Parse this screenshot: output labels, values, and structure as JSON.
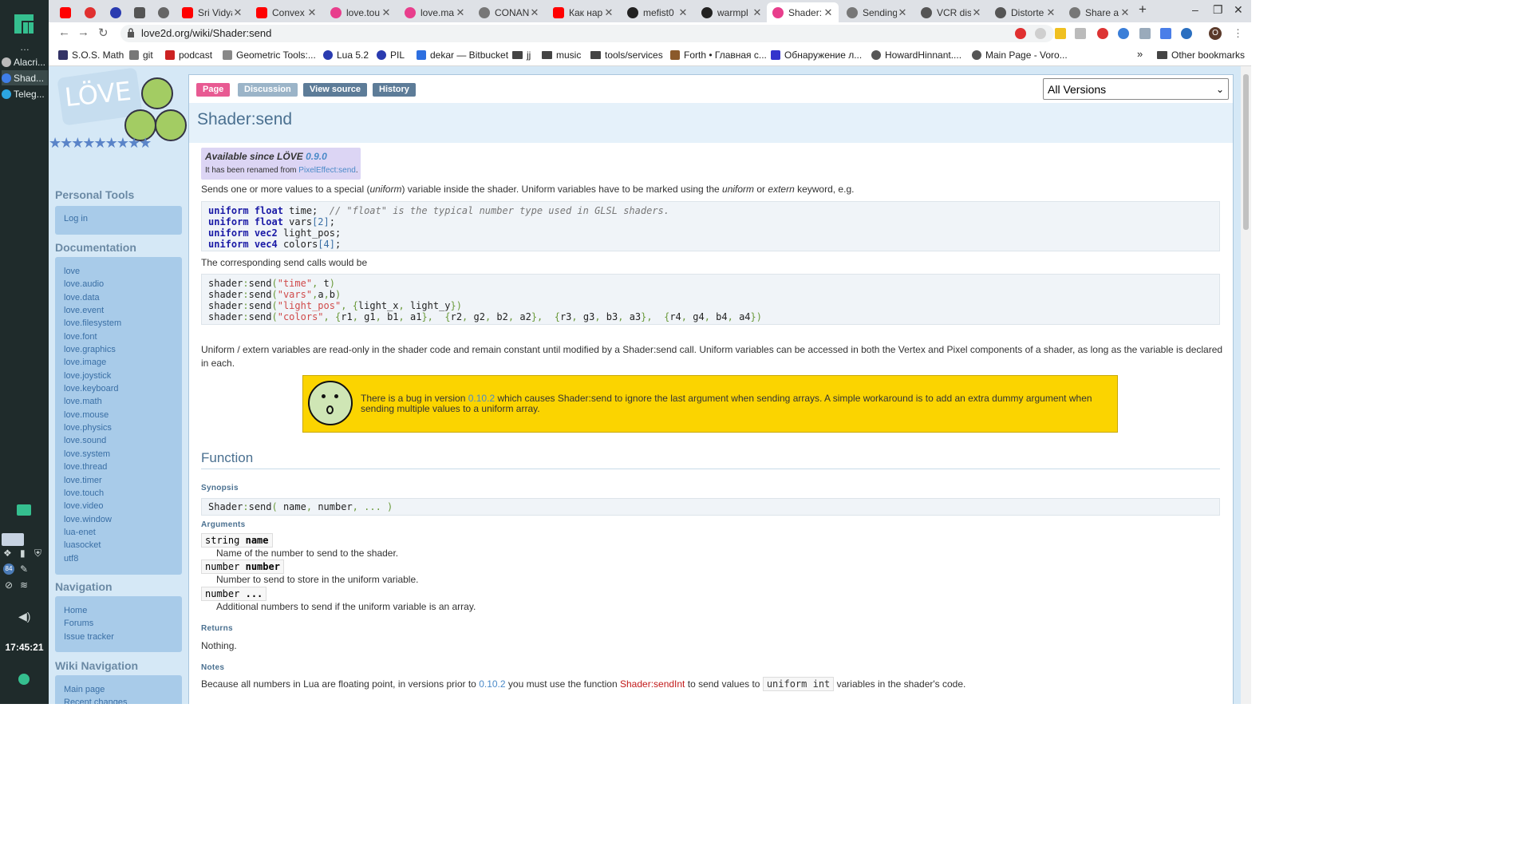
{
  "os_panel": {
    "windows": [
      {
        "label": "Alacri...",
        "color": "#bbbbbb"
      },
      {
        "label": "Shad...",
        "color": "#3f7ee8"
      },
      {
        "label": "Teleg...",
        "color": "#2ca5e0"
      }
    ],
    "badge": "84",
    "clock": "17:45:21"
  },
  "tabs": [
    {
      "title": "",
      "color": "#ff0000"
    },
    {
      "title": "",
      "color": "#e03030"
    },
    {
      "title": "",
      "color": "#2a3bb0"
    },
    {
      "title": "",
      "color": "#555555"
    },
    {
      "title": "",
      "color": "#666666"
    },
    {
      "title": "Sri Vidya",
      "color": "#ff0000"
    },
    {
      "title": "Convex",
      "color": "#ff0000"
    },
    {
      "title": "love.tou",
      "color": "#e83e8c"
    },
    {
      "title": "love.ma",
      "color": "#e83e8c"
    },
    {
      "title": "CONAN",
      "color": "#777777"
    },
    {
      "title": "Как нар",
      "color": "#ff0000"
    },
    {
      "title": "mefist0",
      "color": "#222222"
    },
    {
      "title": "warmpl",
      "color": "#222222"
    },
    {
      "title": "Shader:",
      "color": "#e83e8c"
    },
    {
      "title": "Sending",
      "color": "#777777"
    },
    {
      "title": "VCR dist",
      "color": "#555555"
    },
    {
      "title": "Distorte",
      "color": "#555555"
    },
    {
      "title": "Share a",
      "color": "#777777"
    }
  ],
  "address": {
    "url": "love2d.org/wiki/Shader:send"
  },
  "profile_letter": "O",
  "bookmarks": [
    {
      "label": "S.O.S. Math",
      "color": "#333366"
    },
    {
      "label": "git",
      "color": "#777777"
    },
    {
      "label": "podcast",
      "color": "#cc2222"
    },
    {
      "label": "Geometric Tools:...",
      "color": "#888888"
    },
    {
      "label": "Lua 5.2",
      "color": "#2a3bb0"
    },
    {
      "label": "PIL",
      "color": "#2a3bb0"
    },
    {
      "label": "dekar — Bitbucket",
      "color": "#2d6fe0"
    },
    {
      "label": "jj",
      "color": "folder"
    },
    {
      "label": "music",
      "color": "folder"
    },
    {
      "label": "tools/services",
      "color": "folder"
    },
    {
      "label": "Forth • Главная с...",
      "color": "#8b5a2b"
    },
    {
      "label": "Обнаружение л...",
      "color": "#3333cc"
    },
    {
      "label": "HowardHinnant....",
      "color": "#555555"
    },
    {
      "label": "Main Page - Voro...",
      "color": "#555555"
    }
  ],
  "bookmarks_overflow": "»",
  "other_bookmarks": "Other bookmarks",
  "logo_text": "LÖVE",
  "sidebar": {
    "personal_tools": {
      "heading": "Personal Tools",
      "items": [
        "Log in"
      ]
    },
    "documentation": {
      "heading": "Documentation",
      "items": [
        "love",
        "love.audio",
        "love.data",
        "love.event",
        "love.filesystem",
        "love.font",
        "love.graphics",
        "love.image",
        "love.joystick",
        "love.keyboard",
        "love.math",
        "love.mouse",
        "love.physics",
        "love.sound",
        "love.system",
        "love.thread",
        "love.timer",
        "love.touch",
        "love.video",
        "love.window",
        "lua-enet",
        "luasocket",
        "utf8"
      ]
    },
    "navigation": {
      "heading": "Navigation",
      "items": [
        "Home",
        "Forums",
        "Issue tracker"
      ]
    },
    "wiki_navigation": {
      "heading": "Wiki Navigation",
      "items": [
        "Main page",
        "Recent changes"
      ]
    }
  },
  "page_tabs": [
    {
      "label": "Page",
      "color": "#e85a92"
    },
    {
      "label": "Discussion",
      "color": "#9bb4c8"
    },
    {
      "label": "View source",
      "color": "#5d7c98"
    },
    {
      "label": "History",
      "color": "#5d7c98"
    }
  ],
  "version_select": {
    "value": "All Versions"
  },
  "title": "Shader:send",
  "available": {
    "prefix": "Available since LÖVE",
    "version": "0.9.0",
    "renamed_prefix": "It has been renamed from",
    "renamed_link": "PixelEffect:send",
    "renamed_suffix": "."
  },
  "intro": {
    "p1": "Sends one or more values to a special (",
    "uniform": "uniform",
    "p2": ") variable inside the shader. Uniform variables have to be marked using the ",
    "uniform2": "uniform",
    "or": " or ",
    "extern": "extern",
    "p3": " keyword, e.g."
  },
  "corresponding": "The corresponding send calls would be",
  "readonly_text": "Uniform / extern variables are read-only in the shader code and remain constant until modified by a Shader:send call. Uniform variables can be accessed in both the Vertex and Pixel components of a shader, as long as the variable is declared in each.",
  "bug": {
    "p1": "There is a bug in version ",
    "version": "0.10.2",
    "p2": " which causes Shader:send to ignore the last argument when sending arrays. A simple workaround is to add an extra dummy argument when sending multiple values to a uniform array."
  },
  "function_heading": "Function",
  "synopsis_heading": "Synopsis",
  "arguments_heading": "Arguments",
  "arguments": [
    {
      "type": "string",
      "name": "name",
      "desc": "Name of the number to send to the shader."
    },
    {
      "type": "number",
      "name": "number",
      "desc": "Number to send to store in the uniform variable."
    },
    {
      "type": "number",
      "name": "...",
      "desc": "Additional numbers to send if the uniform variable is an array."
    }
  ],
  "returns_heading": "Returns",
  "returns_text": "Nothing.",
  "notes_heading": "Notes",
  "notes": {
    "p1": "Because all numbers in Lua are floating point, in versions prior to ",
    "version": "0.10.2",
    "p2": " you must use the function ",
    "fn": "Shader:sendInt",
    "p3": " to send values to ",
    "code": "uniform int",
    "p4": " variables in the shader's code."
  }
}
